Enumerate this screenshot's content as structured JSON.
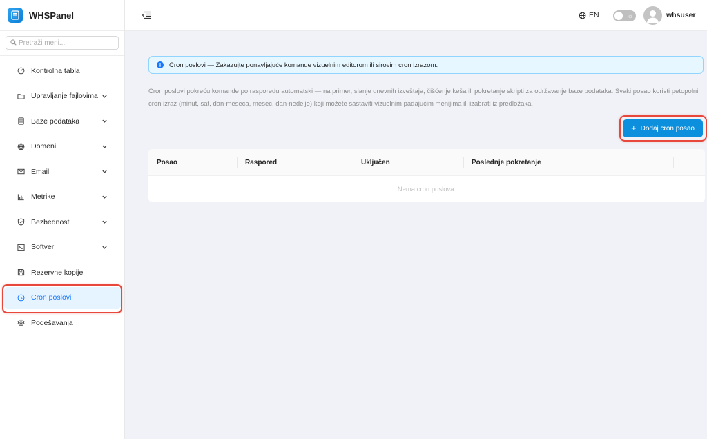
{
  "app": {
    "name": "WHSPanel"
  },
  "search": {
    "placeholder": "Pretraži meni..."
  },
  "sidebar": {
    "items": [
      {
        "label": "Kontrolna tabla",
        "icon": "dashboard-icon",
        "expandable": false
      },
      {
        "label": "Upravljanje fajlovima",
        "icon": "folder-icon",
        "expandable": true
      },
      {
        "label": "Baze podataka",
        "icon": "database-icon",
        "expandable": true
      },
      {
        "label": "Domeni",
        "icon": "globe-icon",
        "expandable": true
      },
      {
        "label": "Email",
        "icon": "mail-icon",
        "expandable": true
      },
      {
        "label": "Metrike",
        "icon": "bar-chart-icon",
        "expandable": true
      },
      {
        "label": "Bezbednost",
        "icon": "shield-icon",
        "expandable": true
      },
      {
        "label": "Softver",
        "icon": "terminal-icon",
        "expandable": true
      },
      {
        "label": "Rezervne kopije",
        "icon": "save-icon",
        "expandable": false
      },
      {
        "label": "Cron poslovi",
        "icon": "clock-icon",
        "expandable": false,
        "active": true
      },
      {
        "label": "Podešavanja",
        "icon": "settings-icon",
        "expandable": false
      }
    ]
  },
  "header": {
    "language": "EN",
    "username": "whsuser"
  },
  "alert": {
    "text": "Cron poslovi — Zakazujte ponavljajuće komande vizuelnim editorom ili sirovim cron izrazom."
  },
  "description": "Cron poslovi pokreću komande po rasporedu automatski — na primer, slanje dnevnih izveštaja, čišćenje keša ili pokretanje skripti za održavanje baze podataka. Svaki posao koristi petopolni cron izraz (minut, sat, dan-meseca, mesec, dan-nedelje) koji možete sastaviti vizuelnim padajućim menijima ili izabrati iz predložaka.",
  "actions": {
    "add_label": "Dodaj cron posao"
  },
  "table": {
    "columns": [
      "Posao",
      "Raspored",
      "Uključen",
      "Poslednje pokretanje"
    ],
    "empty_text": "Nema cron poslova."
  },
  "colors": {
    "accent": "#0c8fdc",
    "active_bg": "#e6f4ff",
    "active_text": "#1677ff",
    "highlight": "#e8483c"
  }
}
